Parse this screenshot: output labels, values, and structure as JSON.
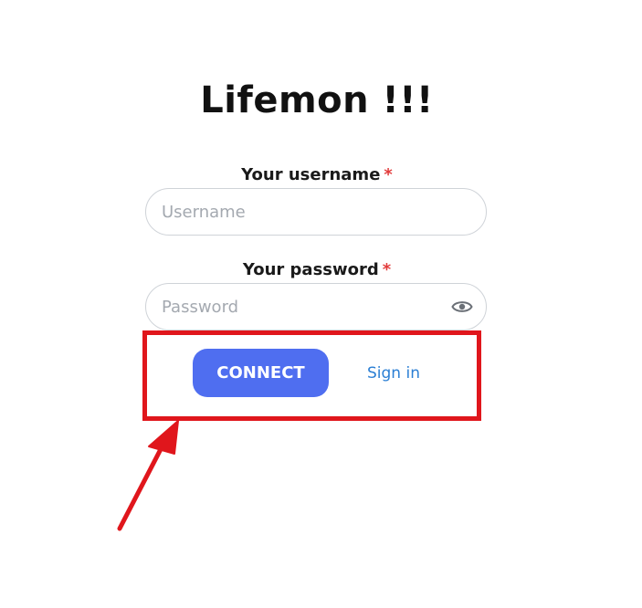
{
  "app": {
    "title": "Lifemon !!!"
  },
  "form": {
    "username": {
      "label": "Your username",
      "required_marker": "*",
      "placeholder": "Username",
      "value": ""
    },
    "password": {
      "label": "Your password",
      "required_marker": "*",
      "placeholder": "Password",
      "value": "",
      "toggle_icon": "eye-icon"
    },
    "actions": {
      "connect_label": "CONNECT",
      "signin_label": "Sign in"
    }
  },
  "annotation": {
    "highlight_color": "#e0161c",
    "arrow_color": "#e0161c"
  },
  "colors": {
    "primary": "#4f6ef0",
    "link": "#2b7fd4",
    "required": "#e23b3b"
  }
}
